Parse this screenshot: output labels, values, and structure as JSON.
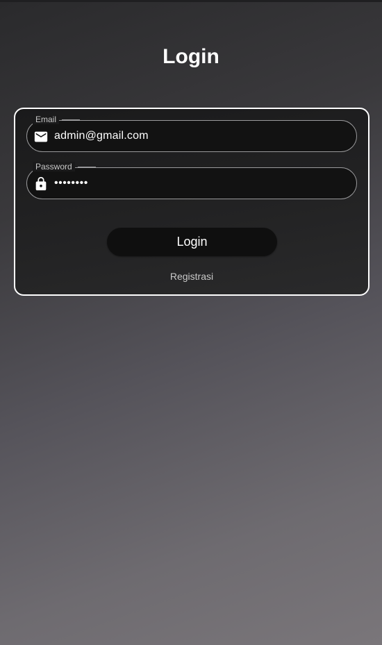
{
  "header": {
    "title": "Login"
  },
  "form": {
    "email": {
      "label": "Email",
      "value": "admin@gmail.com",
      "icon": "mail-icon"
    },
    "password": {
      "label": "Password",
      "value": "••••••••",
      "icon": "lock-icon"
    },
    "login_label": "Login",
    "register_label": "Registrasi"
  },
  "colors": {
    "background_top": "#2a2a2c",
    "background_bottom": "#7a767a",
    "card_border": "#ffffff",
    "field_background": "#121212",
    "button_background": "#0f0f0f"
  }
}
